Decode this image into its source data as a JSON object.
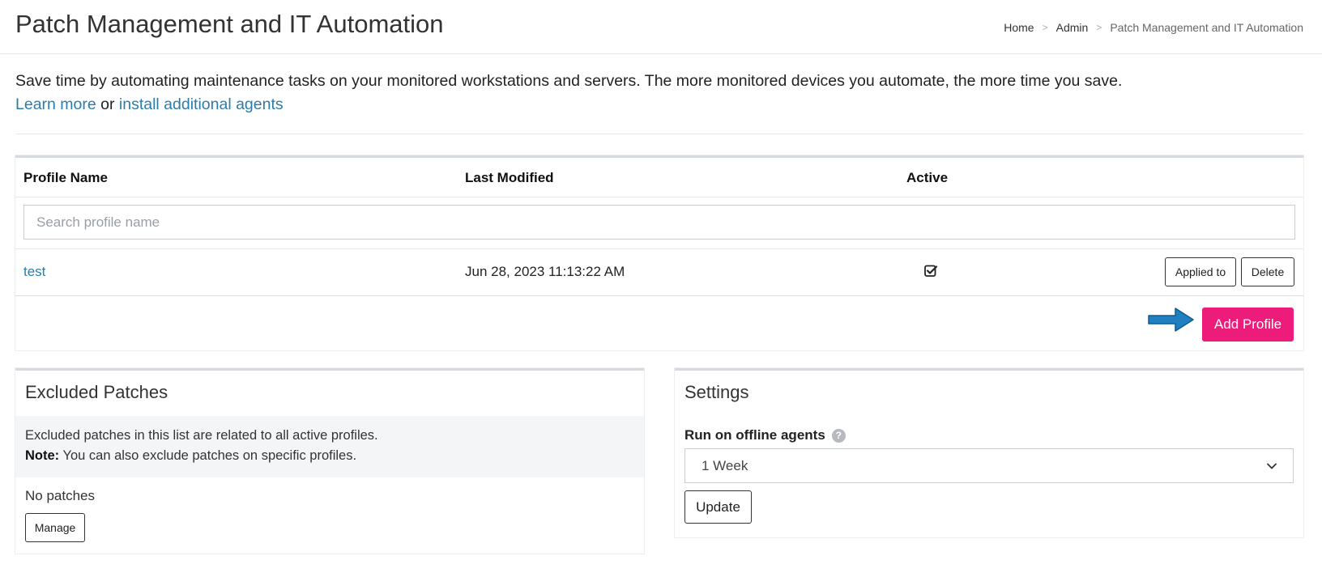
{
  "header": {
    "title": "Patch Management and IT Automation",
    "breadcrumb": [
      "Home",
      "Admin",
      "Patch Management and IT Automation"
    ],
    "separator": ">"
  },
  "intro": {
    "text": "Save time by automating maintenance tasks on your monitored workstations and servers. The more monitored devices you automate, the more time you save.",
    "learn_more": "Learn more",
    "or": "or",
    "install_link": "install additional agents"
  },
  "profiles": {
    "columns": [
      "Profile Name",
      "Last Modified",
      "Active"
    ],
    "search_placeholder": "Search profile name",
    "rows": [
      {
        "name": "test",
        "last_modified": "Jun 28, 2023 11:13:22 AM",
        "active": true,
        "applied_label": "Applied to",
        "delete_label": "Delete"
      }
    ],
    "add_label": "Add Profile"
  },
  "excluded": {
    "title": "Excluded Patches",
    "info_text": "Excluded patches in this list are related to all active profiles.",
    "note_label": "Note:",
    "note_text": " You can also exclude patches on specific profiles.",
    "empty_text": "No patches",
    "manage_label": "Manage"
  },
  "settings": {
    "title": "Settings",
    "field_label": "Run on offline agents",
    "help_glyph": "?",
    "selected": "1 Week",
    "update_label": "Update"
  },
  "colors": {
    "accent": "#ed1b7a",
    "link": "#2a7dab",
    "arrow": "#1f7fc1"
  }
}
